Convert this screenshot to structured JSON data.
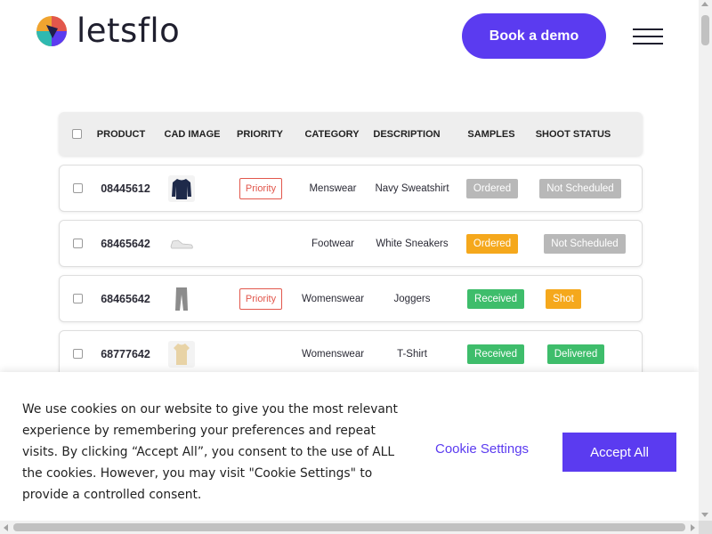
{
  "header": {
    "logo_text": "letsflo",
    "demo_button": "Book a demo",
    "menu_icon": "hamburger-menu-icon"
  },
  "table": {
    "columns": [
      "PRODUCT",
      "CAD IMAGE",
      "PRIORITY",
      "CATEGORY",
      "DESCRIPTION",
      "SAMPLES",
      "SHOOT STATUS"
    ],
    "rows": [
      {
        "product": "08445612",
        "image": "navy-sweatshirt-icon",
        "priority": "Priority",
        "category": "Menswear",
        "description": "Navy Sweatshirt",
        "samples": "Ordered",
        "shoot_status": "Not Scheduled"
      },
      {
        "product": "68465642",
        "image": "white-sneakers-icon",
        "priority": "",
        "category": "Footwear",
        "description": "White Sneakers",
        "samples": "Ordered",
        "shoot_status": "Not Scheduled"
      },
      {
        "product": "68465642",
        "image": "joggers-icon",
        "priority": "Priority",
        "category": "Womenswear",
        "description": "Joggers",
        "samples": "Received",
        "shoot_status": "Shot"
      },
      {
        "product": "68777642",
        "image": "tshirt-icon",
        "priority": "",
        "category": "Womenswear",
        "description": "T-Shirt",
        "samples": "Received",
        "shoot_status": "Delivered"
      }
    ],
    "badge_colors": {
      "grey": "#b8b8b8",
      "orange": "#f5a81c",
      "green": "#3ebd6b",
      "priority": "#e2574c"
    }
  },
  "cookie": {
    "text": "We use cookies on our website to give you the most relevant experience by remembering your preferences and repeat visits. By clicking “Accept All”, you consent to the use of ALL the cookies. However, you may visit \"Cookie Settings\" to provide a controlled consent.",
    "settings_label": "Cookie Settings",
    "accept_label": "Accept All"
  },
  "colors": {
    "brand": "#5b3bf0"
  }
}
